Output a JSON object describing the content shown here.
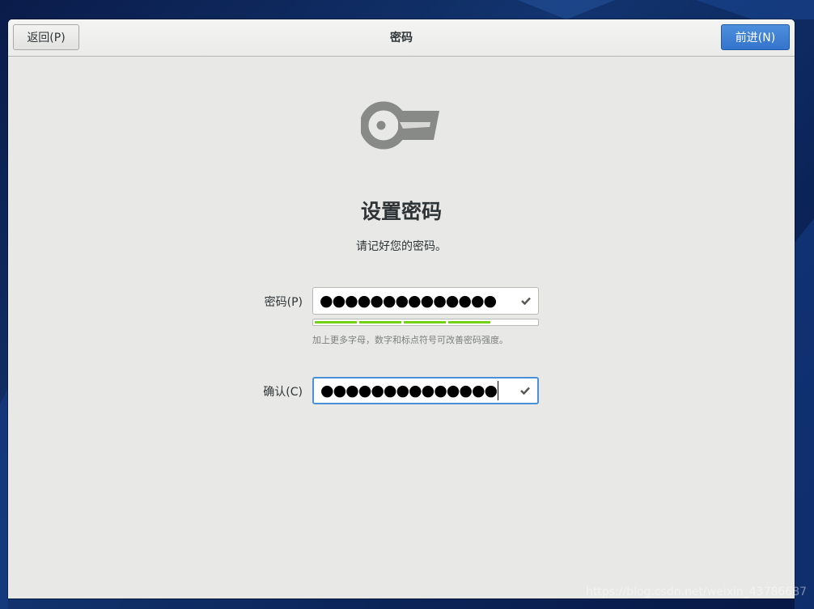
{
  "header": {
    "back_label": "返回(P)",
    "title": "密码",
    "next_label": "前进(N)"
  },
  "main": {
    "title": "设置密码",
    "subtitle": "请记好您的密码。",
    "password": {
      "label": "密码(P)",
      "masked_value": "●●●●●●●●●●●●●●"
    },
    "strength": {
      "level": 0.8,
      "hint": "加上更多字母，数字和标点符号可改善密码强度。"
    },
    "confirm": {
      "label": "确认(C)",
      "masked_value": "●●●●●●●●●●●●●●"
    }
  },
  "watermark": "https://blog.csdn.net/weixin_43786687",
  "colors": {
    "accent": "#3474cc",
    "strength": "#73d216",
    "window_bg": "#e8e8e7"
  },
  "icons": [
    "key-icon",
    "check-icon"
  ]
}
